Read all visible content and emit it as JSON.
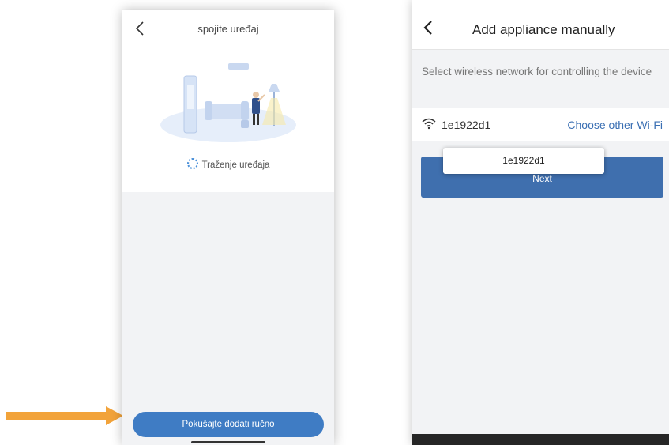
{
  "left_screen": {
    "title": "spojite uređaj",
    "status_text": "Traženje uređaja",
    "manual_button_label": "Pokušajte dodati ručno"
  },
  "right_screen": {
    "title": "Add appliance manually",
    "description": "Select wireless network for controlling the device",
    "wifi_name": "1e1922d1",
    "choose_wifi_label": "Choose other Wi-Fi",
    "next_button_label": "Next",
    "tooltip_text": "1e1922d1"
  },
  "colors": {
    "primary_blue": "#3f7cc4",
    "link_blue": "#3a6fb3",
    "arrow_orange": "#f2a33a"
  },
  "icons": [
    "back-chevron-icon",
    "spinner-icon",
    "wifi-icon"
  ]
}
